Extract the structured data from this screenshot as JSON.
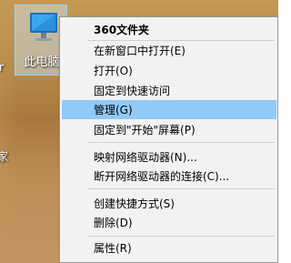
{
  "desktop": {
    "shortcut_label": "此电脑",
    "edge_text_1": "r",
    "edge_text_2": "家"
  },
  "context_menu": {
    "items": [
      {
        "label": "360文件夹",
        "bold": true
      },
      {
        "label": "在新窗口中打开(E)"
      },
      {
        "label": "打开(O)"
      },
      {
        "label": "固定到快速访问"
      },
      {
        "label": "管理(G)",
        "highlighted": true
      },
      {
        "label": "固定到\"开始\"屏幕(P)"
      },
      {
        "label": "映射网络驱动器(N)..."
      },
      {
        "label": "断开网络驱动器的连接(C)..."
      },
      {
        "label": "创建快捷方式(S)"
      },
      {
        "label": "删除(D)"
      },
      {
        "label": "属性(R)"
      }
    ]
  },
  "colors": {
    "highlight": "#91c9f7",
    "menu_bg": "#f2f2f2",
    "selection_bg": "#cce8ff"
  }
}
